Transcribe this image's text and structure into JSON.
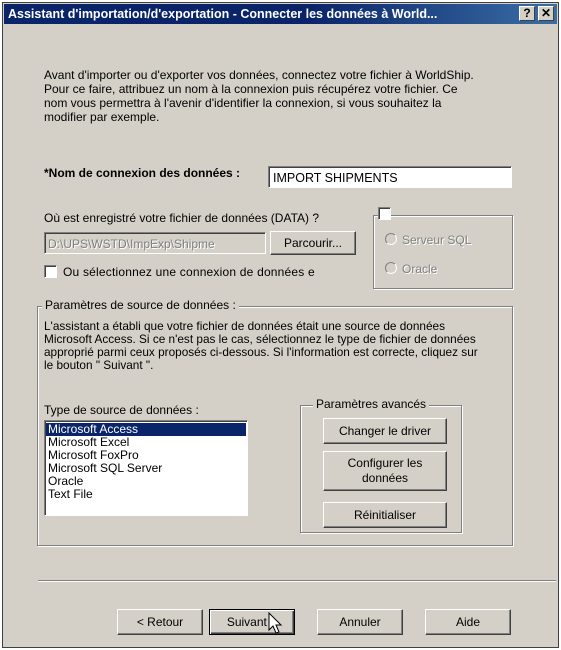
{
  "window": {
    "title": "Assistant d'importation/d'exportation - Connecter les données à World...",
    "help_glyph": "?",
    "close_glyph": "✕"
  },
  "intro_text": "Avant d'importer ou d'exporter vos données, connectez votre fichier à WorldShip. Pour ce faire, attribuez un nom à la connexion puis récupérez votre fichier. Ce nom vous permettra à l'avenir d'identifier la connexion, si vous souhaitez la modifier par exemple.",
  "connection_name": {
    "label": "*Nom de connexion des données :",
    "value": "IMPORT SHIPMENTS"
  },
  "data_file": {
    "label": "Où est enregistré votre fichier de données (DATA) ?",
    "path_value": "D:\\UPS\\WSTD\\ImpExp\\Shipme",
    "browse_label": "Parcourir...",
    "existing_connection_label": "Ou sélectionnez une connexion de données e"
  },
  "server_options": {
    "sql_server_label": "Serveur SQL",
    "oracle_label": "Oracle"
  },
  "source_params": {
    "group_label": "Paramètres de source de données :",
    "description": "L'assistant a établi que votre fichier de données était une source de données Microsoft Access. Si ce n'est pas le cas, sélectionnez le type de fichier de données approprié parmi ceux proposés ci-dessous. Si l'information est correcte, cliquez sur le bouton \" Suivant \".",
    "type_label": "Type de source de données :",
    "types": [
      "Microsoft Access",
      "Microsoft Excel",
      "Microsoft FoxPro",
      "Microsoft SQL Server",
      "Oracle",
      "Text File"
    ],
    "selected_index": 0
  },
  "advanced": {
    "group_label": "Paramètres avancés",
    "change_driver_label": "Changer le driver",
    "configure_label": "Configurer les données",
    "reset_label": "Réinitialiser"
  },
  "footer": {
    "back_label": "< Retour",
    "next_label": "Suivant >",
    "cancel_label": "Annuler",
    "help_label": "Aide"
  }
}
